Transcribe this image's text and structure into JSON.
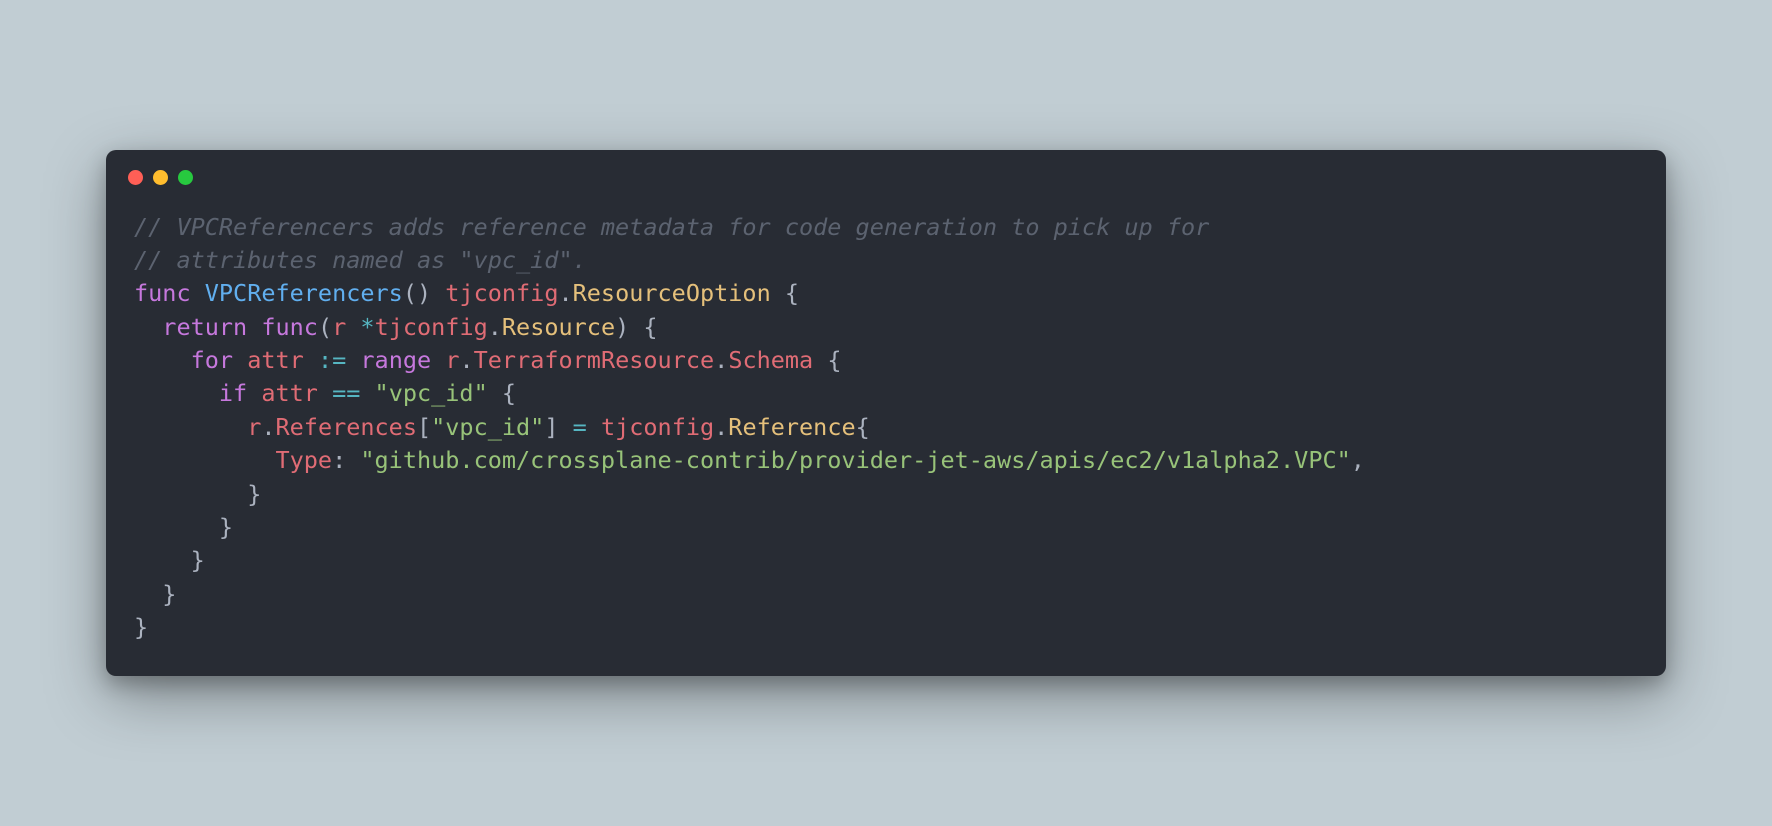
{
  "titlebar": {
    "dots": [
      "red",
      "yellow",
      "green"
    ]
  },
  "code": {
    "comment1": "// VPCReferencers adds reference metadata for code generation to pick up for",
    "comment2": "// attributes named as \"vpc_id\".",
    "kw_func": "func",
    "fn_name": "VPCReferencers",
    "ret_pkg": "tjconfig",
    "ret_type": "ResourceOption",
    "kw_return": "return",
    "kw_func2": "func",
    "param_r": "r",
    "param_star": "*",
    "param_pkg": "tjconfig",
    "param_type": "Resource",
    "kw_for": "for",
    "var_attr": "attr",
    "op_decl": ":=",
    "kw_range": "range",
    "rvar": "r",
    "fld_tr": "TerraformResource",
    "fld_schema": "Schema",
    "kw_if": "if",
    "cond_attr": "attr",
    "op_eq": "==",
    "str_vpcid1": "\"vpc_id\"",
    "rvar2": "r",
    "fld_refs": "References",
    "str_vpcid2": "\"vpc_id\"",
    "op_assign": "=",
    "ref_pkg": "tjconfig",
    "ref_type": "Reference",
    "fld_type": "Type",
    "str_typeval": "\"github.com/crossplane-contrib/provider-jet-aws/apis/ec2/v1alpha2.VPC\"",
    "brace_open": "{",
    "brace_close": "}",
    "paren_open": "(",
    "paren_close": ")",
    "bracket_open": "[",
    "bracket_close": "]",
    "dot": ".",
    "comma": ",",
    "colon": ":",
    "space": " "
  }
}
